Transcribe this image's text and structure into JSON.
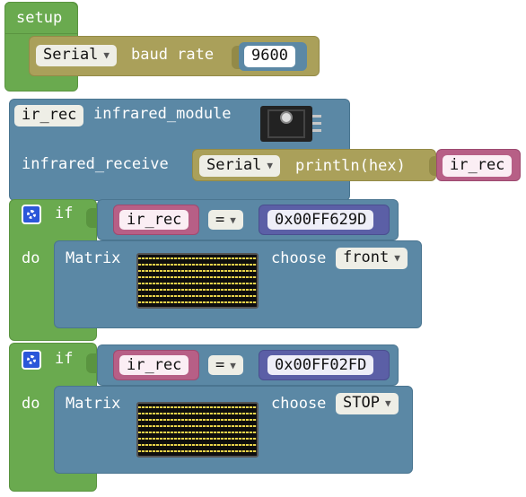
{
  "setup": {
    "title": "setup",
    "serial_label": "Serial",
    "baud_text": "baud rate",
    "baud_value": "9600"
  },
  "ir_block": {
    "var_name": "ir_rec",
    "module_label": "infrared_module",
    "receive_label": "infrared_receive",
    "serial_label": "Serial",
    "println_label": "println(hex)",
    "println_arg": "ir_rec"
  },
  "if_blocks": [
    {
      "if_label": "if",
      "do_label": "do",
      "lhs": "ir_rec",
      "op": "=",
      "rhs": "0x00FF629D",
      "matrix_label": "Matrix",
      "choose_label": "choose",
      "choose_value": "front"
    },
    {
      "if_label": "if",
      "do_label": "do",
      "lhs": "ir_rec",
      "op": "=",
      "rhs": "0x00FF02FD",
      "matrix_label": "Matrix",
      "choose_label": "choose",
      "choose_value": "STOP"
    }
  ],
  "colors": {
    "green": "#6aaa4f",
    "olive": "#aaa05a",
    "teal": "#5b88a5",
    "pink": "#b75f86",
    "indigo": "#5b5fa6"
  },
  "icons": [
    "gear-icon",
    "dropdown-arrow-icon",
    "ir-sensor-image",
    "led-matrix-image"
  ]
}
